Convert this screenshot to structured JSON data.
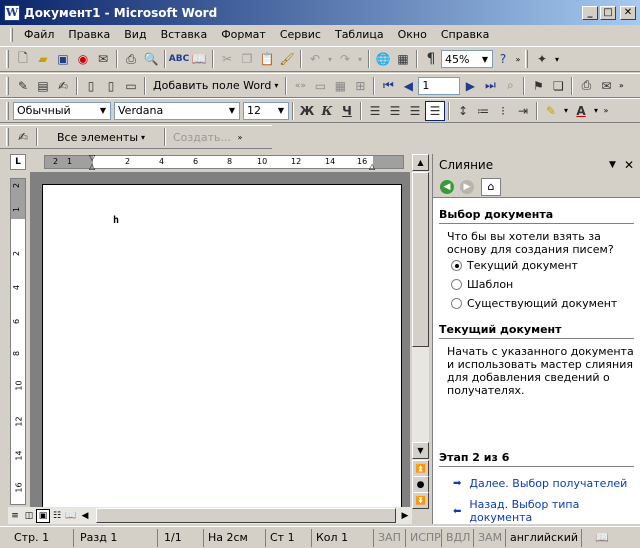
{
  "window": {
    "title": "Документ1 - Microsoft Word",
    "app_icon": "W"
  },
  "menu": [
    "Файл",
    "Правка",
    "Вид",
    "Вставка",
    "Формат",
    "Сервис",
    "Таблица",
    "Окно",
    "Справка"
  ],
  "standard_toolbar": {
    "zoom": "45%"
  },
  "mailmerge_toolbar": {
    "insert_field": "Добавить поле Word",
    "record_number": "1"
  },
  "formatting_toolbar": {
    "style": "Обычный",
    "font": "Verdana",
    "size": "12",
    "bold": "Ж",
    "italic": "К",
    "underline": "Ч"
  },
  "reviewing_toolbar": {
    "show": "Все элементы",
    "create": "Создать..."
  },
  "ruler": {
    "h_ticks": [
      "2",
      "1",
      "2",
      "4",
      "6",
      "8",
      "10",
      "12",
      "14",
      "16"
    ],
    "v_ticks": [
      "2",
      "1",
      "2",
      "4",
      "6",
      "8",
      "10",
      "12",
      "14",
      "16"
    ]
  },
  "document": {
    "glyph": "h"
  },
  "taskpane": {
    "title": "Слияние",
    "section1": {
      "header": "Выбор документа",
      "question": "Что бы вы хотели взять за основу для создания писем?",
      "options": [
        {
          "label": "Текущий документ",
          "selected": true
        },
        {
          "label": "Шаблон",
          "selected": false
        },
        {
          "label": "Существующий документ",
          "selected": false
        }
      ]
    },
    "section2": {
      "header": "Текущий документ",
      "description": "Начать с указанного документа и использовать мастер слияния для добавления сведений о получателях."
    },
    "step": "Этап 2 из 6",
    "next_link": "Далее. Выбор получателей",
    "back_link": "Назад. Выбор типа документа"
  },
  "status": {
    "page": "Стр. 1",
    "section": "Разд 1",
    "pages": "1/1",
    "at": "На 2см",
    "line": "Ст 1",
    "col": "Кол 1",
    "rec": "ЗАП",
    "trk": "ИСПР",
    "ext": "ВДЛ",
    "ovr": "ЗАМ",
    "language": "английский"
  },
  "colors": {
    "title_start": "#0a246a",
    "title_end": "#a6caf0",
    "link": "#0b3daa"
  }
}
